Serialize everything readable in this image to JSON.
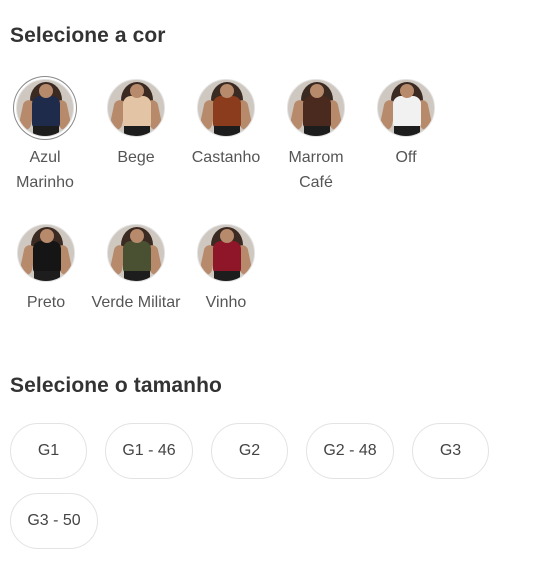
{
  "color_section": {
    "title": "Selecione a cor",
    "colors": [
      {
        "label": "Azul Marinho",
        "top_color": "#1f2b4a",
        "selected": true
      },
      {
        "label": "Bege",
        "top_color": "#e3c4a4",
        "selected": false
      },
      {
        "label": "Castanho",
        "top_color": "#8a3c1c",
        "selected": false
      },
      {
        "label": "Marrom Café",
        "top_color": "#4a2a1e",
        "selected": false
      },
      {
        "label": "Off",
        "top_color": "#f1f1f1",
        "selected": false
      },
      {
        "label": "Preto",
        "top_color": "#151515",
        "selected": false
      },
      {
        "label": "Verde Militar",
        "top_color": "#4a5133",
        "selected": false
      },
      {
        "label": "Vinho",
        "top_color": "#8e1628",
        "selected": false
      }
    ]
  },
  "size_section": {
    "title": "Selecione o tamanho",
    "sizes": [
      "G1",
      "G1 - 46",
      "G2",
      "G2 - 48",
      "G3",
      "G3 - 50"
    ]
  }
}
